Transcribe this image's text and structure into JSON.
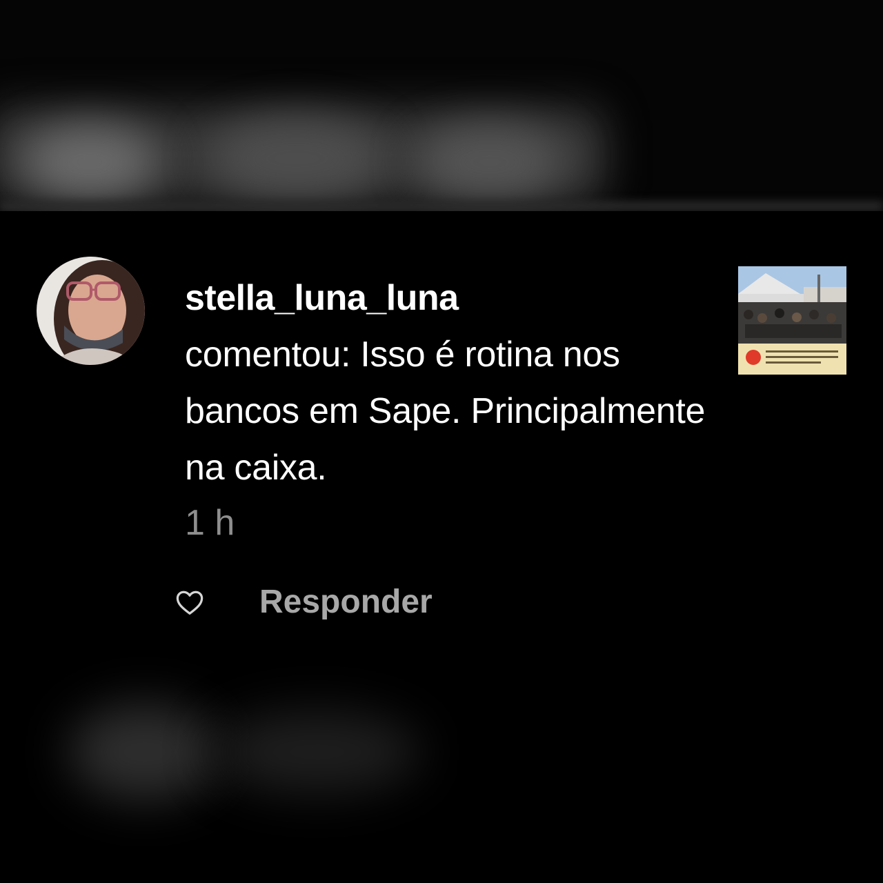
{
  "comment": {
    "username": "stella_luna_luna",
    "text": "comentou: Isso é rotina nos bancos em Sape. Principalmente na caixa.",
    "timestamp": "1 h",
    "reply_label": "Responder"
  },
  "icons": {
    "like": "heart-outline-icon"
  },
  "colors": {
    "background": "#000000",
    "primary_text": "#ffffff",
    "secondary_text": "#8e8e8e",
    "reply_text": "#a8a8a8"
  }
}
